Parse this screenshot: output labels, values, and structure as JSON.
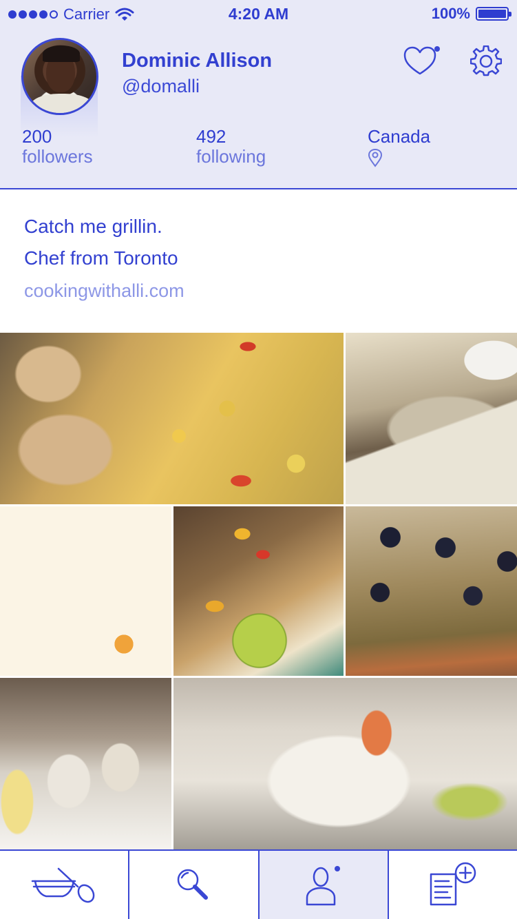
{
  "status_bar": {
    "carrier": "Carrier",
    "time": "4:20 AM",
    "battery": "100%",
    "signal_icon": "signal-dots-icon",
    "wifi_icon": "wifi-icon",
    "battery_icon": "battery-icon",
    "battery_level": 1.0
  },
  "profile": {
    "name": "Dominic Allison",
    "handle": "@domalli",
    "followers_count": "200",
    "followers_label": "followers",
    "following_count": "492",
    "following_label": "following",
    "location": "Canada",
    "location_icon": "location-pin-icon",
    "avatar_icon": "avatar"
  },
  "header_actions": {
    "favorites_icon": "heart-icon",
    "settings_icon": "gear-icon"
  },
  "bio": {
    "line1": "Catch me grillin.",
    "line2": "Chef from Toronto",
    "link": "cookingwithalli.com"
  },
  "grid": {
    "photos": [
      "food-photo",
      "food-photo",
      "food-photo",
      "food-photo",
      "food-photo",
      "food-photo",
      "food-photo"
    ]
  },
  "tabbar": {
    "tabs": [
      "cooking-bowl-icon",
      "search-icon",
      "profile-icon",
      "new-recipe-icon"
    ],
    "active_tab": "profile-icon"
  },
  "colors": {
    "accent": "#3240d0",
    "header_bg": "#e8e9f7",
    "secondary_text": "#6b76dc",
    "link": "#8d97e6"
  }
}
